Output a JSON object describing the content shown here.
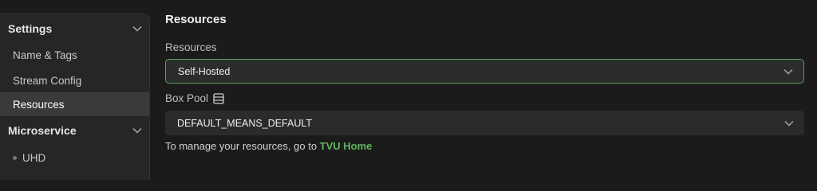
{
  "sidebar": {
    "sections": [
      {
        "title": "Settings",
        "items": [
          {
            "label": "Name & Tags"
          },
          {
            "label": "Stream Config"
          },
          {
            "label": "Resources",
            "active": true
          }
        ]
      },
      {
        "title": "Microservice",
        "items": [
          {
            "label": "UHD"
          }
        ]
      }
    ]
  },
  "main": {
    "title": "Resources",
    "resources_field": {
      "label": "Resources",
      "value": "Self-Hosted"
    },
    "box_pool_field": {
      "label": "Box Pool",
      "value": "DEFAULT_MEANS_DEFAULT"
    },
    "hint": {
      "text": "To manage your resources, go to ",
      "link": "TVU Home"
    }
  },
  "colors": {
    "accent": "#5fb55f",
    "focus_border": "#5aa05e",
    "active_item_bg": "#3a3a3a"
  }
}
